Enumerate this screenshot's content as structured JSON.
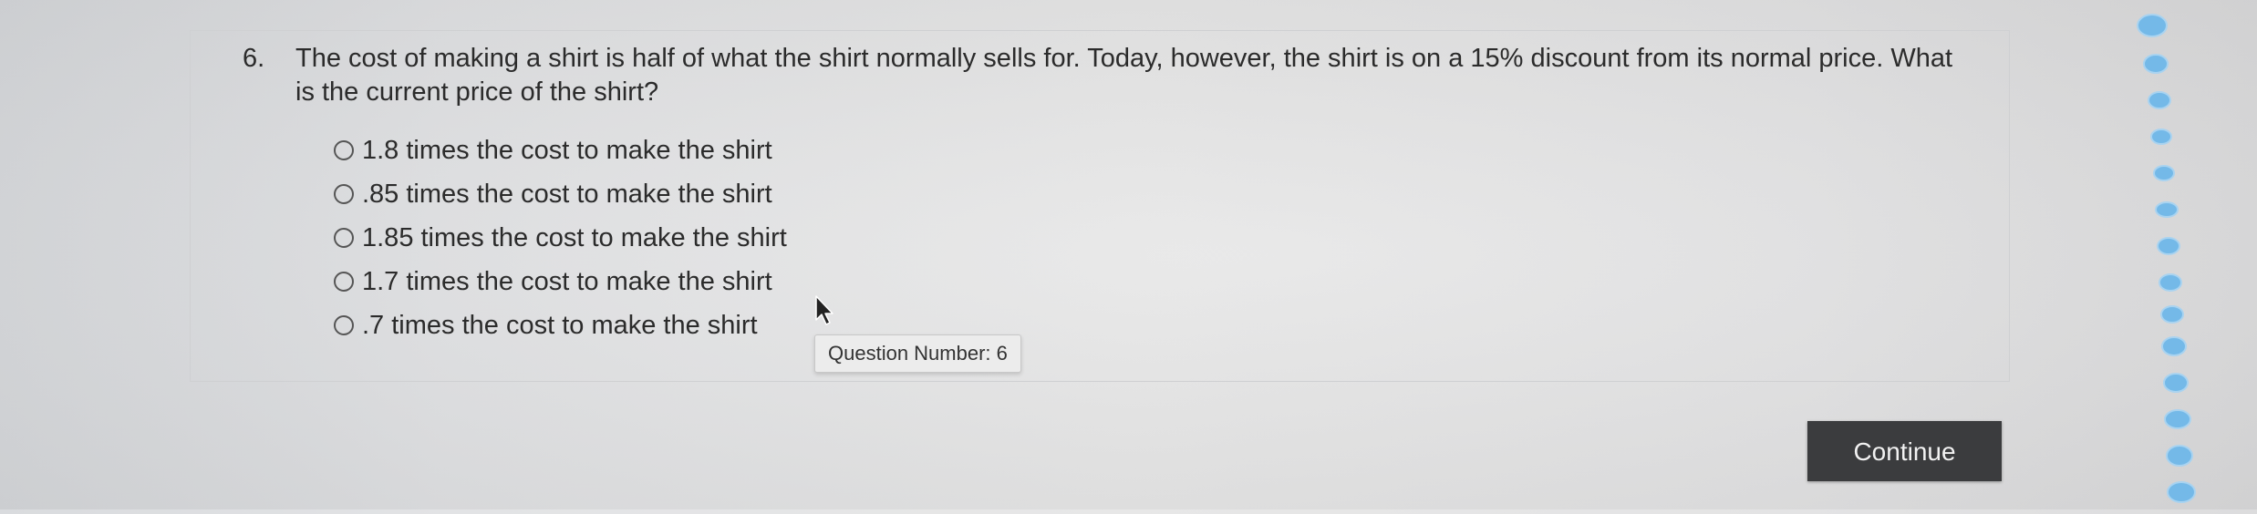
{
  "question": {
    "number": "6.",
    "text": "The cost of making a shirt is half of what the shirt normally sells for. Today, however, the shirt is on a 15% discount from its normal price. What is the current price of the shirt?"
  },
  "options": [
    {
      "label": "1.8 times the cost to make the shirt",
      "selected": false
    },
    {
      "label": ".85 times the cost to make the shirt",
      "selected": false
    },
    {
      "label": "1.85 times the cost to make the shirt",
      "selected": false
    },
    {
      "label": "1.7 times the cost to make the shirt",
      "selected": false
    },
    {
      "label": ".7 times the cost to make the shirt",
      "selected": false
    }
  ],
  "tooltip": {
    "text": "Question Number: 6"
  },
  "footer": {
    "continue_label": "Continue"
  },
  "colors": {
    "button_bg": "#3b3c3e",
    "decoration_accent": "#6ab6ea"
  }
}
